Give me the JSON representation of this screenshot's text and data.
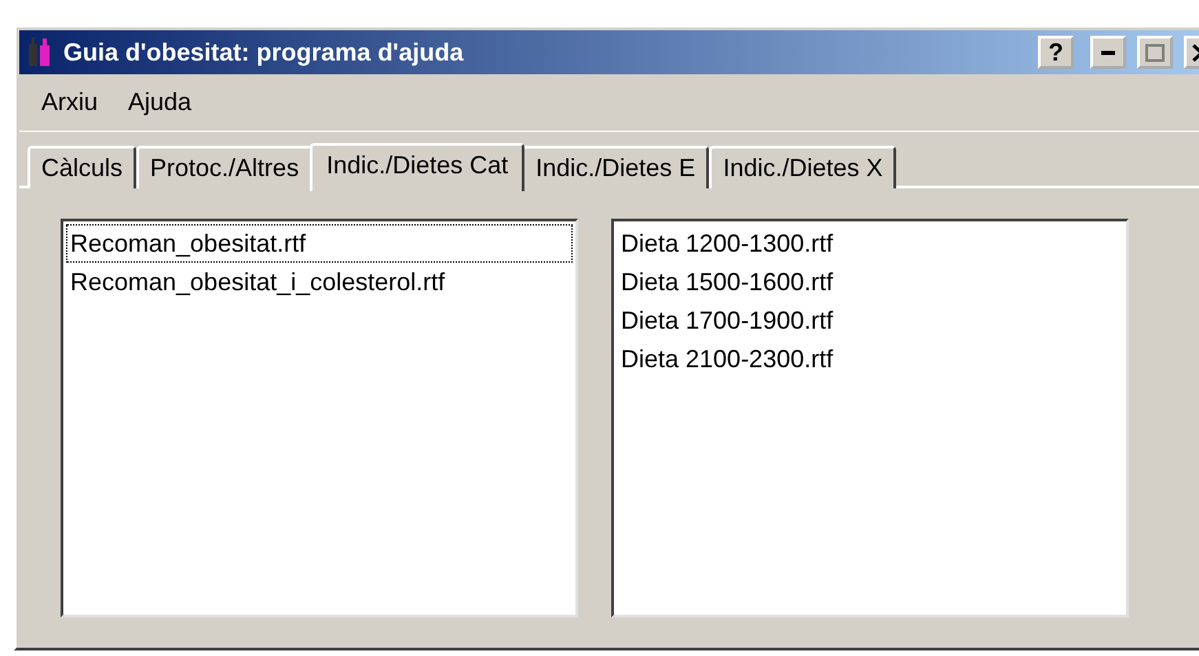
{
  "window": {
    "title": "Guia d'obesitat: programa d'ajuda",
    "help_button": "?"
  },
  "menu": [
    "Arxiu",
    "Ajuda"
  ],
  "tabs": [
    {
      "label": "Càlculs",
      "selected": false
    },
    {
      "label": "Protoc./Altres",
      "selected": false
    },
    {
      "label": "Indic./Dietes Cat",
      "selected": true
    },
    {
      "label": "Indic./Dietes E",
      "selected": false
    },
    {
      "label": "Indic./Dietes X",
      "selected": false
    }
  ],
  "lists": [
    {
      "items": [
        {
          "label": "Recoman_obesitat.rtf",
          "focused": true
        },
        {
          "label": "Recoman_obesitat_i_colesterol.rtf",
          "focused": false
        }
      ]
    },
    {
      "items": [
        {
          "label": "Dieta 1200-1300.rtf",
          "focused": false
        },
        {
          "label": "Dieta 1500-1600.rtf",
          "focused": false
        },
        {
          "label": "Dieta 1700-1900.rtf",
          "focused": false
        },
        {
          "label": "Dieta 2100-2300.rtf",
          "focused": false
        }
      ]
    }
  ]
}
